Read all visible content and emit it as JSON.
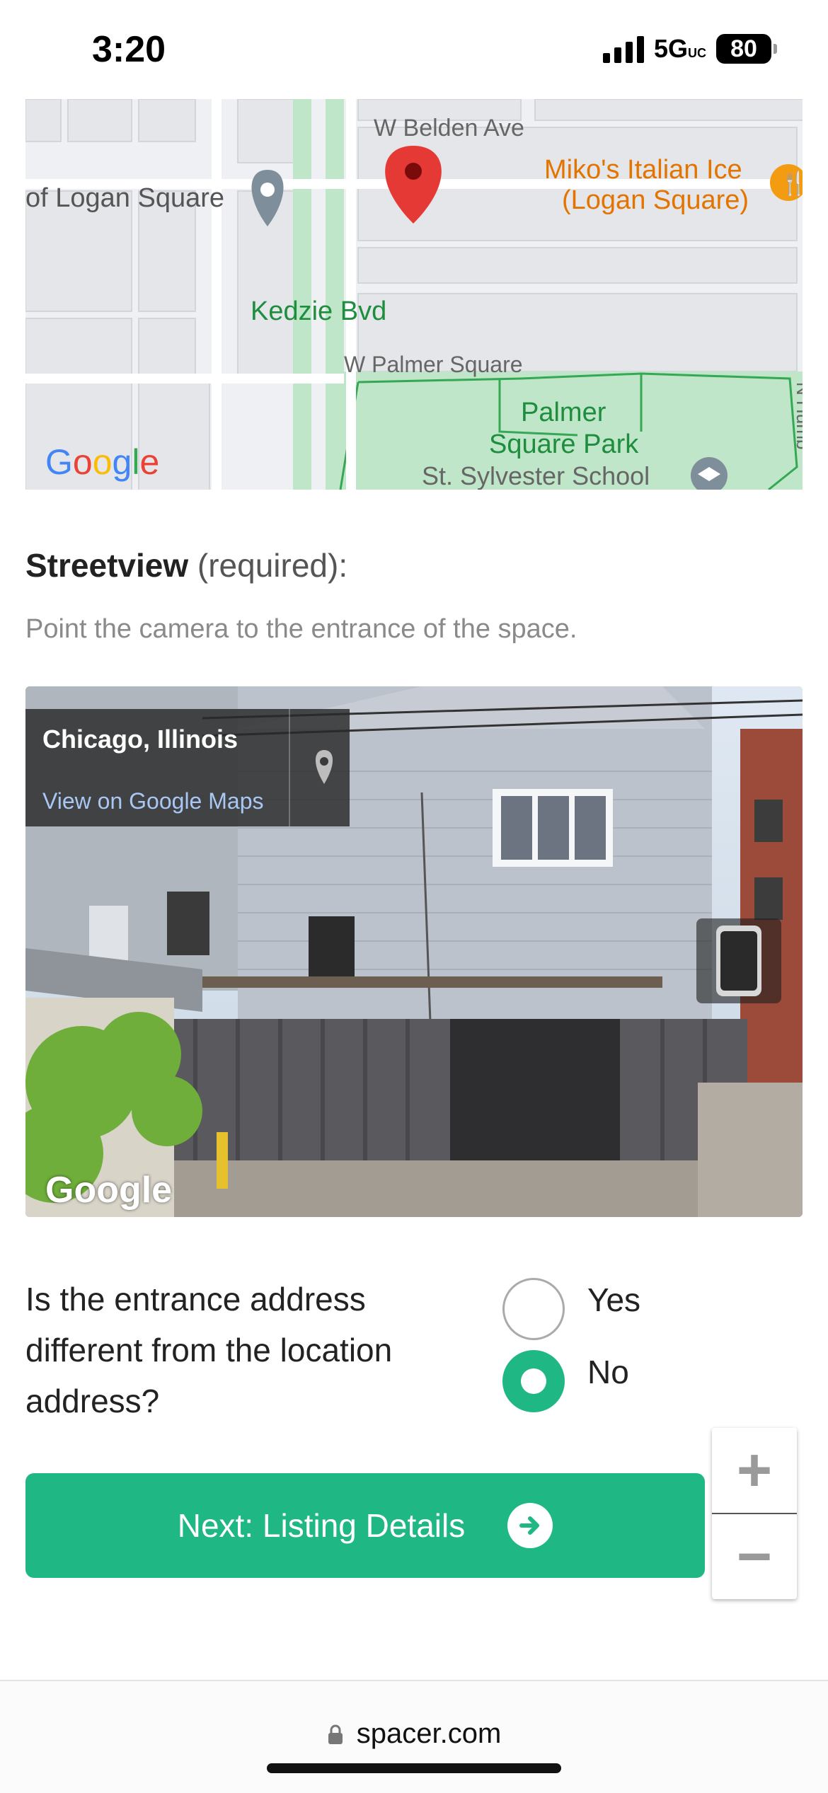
{
  "status_bar": {
    "time": "3:20",
    "network": "5G",
    "network_suffix": "UC",
    "battery": "80"
  },
  "map": {
    "streets": {
      "belden": "W Belden Ave",
      "kedzie": "Kedzie Bvd",
      "palmer": "W Palmer Square",
      "logan_fragment": "of Logan Square",
      "school": "St. Sylvester School",
      "park_line1": "Palmer",
      "park_line2": "Square Park",
      "mikos_line1": "Miko's Italian Ice",
      "mikos_line2": "(Logan Square)",
      "edge_fragment": "N Humb"
    },
    "logo": "Google"
  },
  "streetview": {
    "title": "Streetview",
    "required": " (required):",
    "hint": "Point the camera to the entrance of the space.",
    "place": "Chicago, Illinois",
    "link": "View on Google Maps",
    "logo": "Google"
  },
  "question": {
    "text": "Is the entrance address different from the location address?",
    "options": {
      "yes": "Yes",
      "no": "No"
    },
    "selected": "No"
  },
  "next_button": {
    "label": "Next: Listing Details"
  },
  "zoom": {
    "plus": "+",
    "minus": "−"
  },
  "browser": {
    "url": "spacer.com"
  },
  "colors": {
    "accent": "#1fb783",
    "pin": "#e53935",
    "park": "#bfe6c9"
  }
}
